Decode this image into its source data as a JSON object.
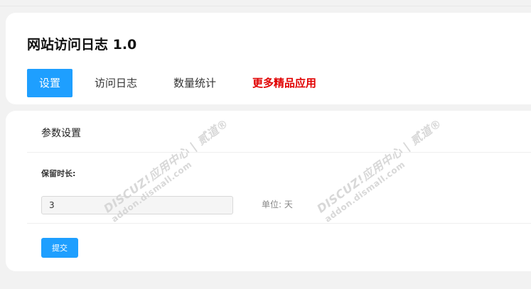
{
  "app": {
    "title": "网站访问日志 1.0"
  },
  "tabs": [
    {
      "label": "设置",
      "active": true
    },
    {
      "label": "访问日志",
      "active": false
    },
    {
      "label": "数量统计",
      "active": false
    },
    {
      "label": "更多精品应用",
      "active": false
    }
  ],
  "settings": {
    "section_title": "参数设置",
    "field_label": "保留时长:",
    "field_value": "3",
    "field_hint": "单位: 天",
    "submit_label": "提交"
  },
  "watermark": {
    "line1": "DISCUZ!应用中心 | 贰道®",
    "line2": "addon.dismall.com"
  },
  "colors": {
    "accent": "#1e9fff",
    "promo": "#e10000",
    "background": "#f2f2f2"
  }
}
